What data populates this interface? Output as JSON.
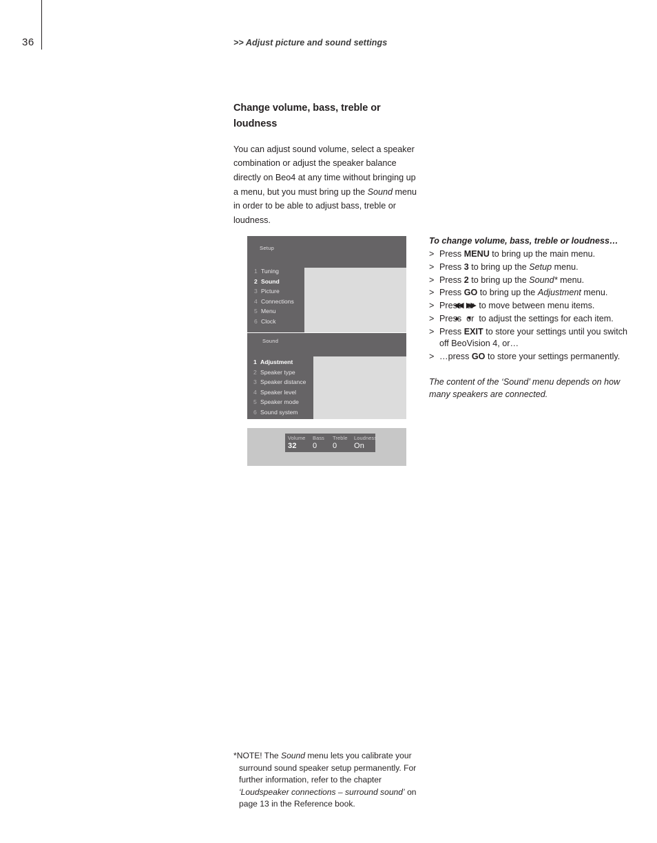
{
  "page": {
    "number": "36",
    "running_head": ">> Adjust picture and sound settings"
  },
  "left_column": {
    "heading": "Change volume, bass, treble or loudness",
    "intro_part1": "You can adjust sound volume, select a speaker combination or adjust the speaker balance directly on Beo4 at any time without bringing up a menu, but you must bring up the ",
    "intro_italic": "Sound",
    "intro_part2": " menu in order to be able to adjust bass, treble or loudness."
  },
  "tv_graphic": {
    "setup_menu": {
      "title": "Setup",
      "items": [
        {
          "num": "1",
          "label": "Tuning",
          "selected": false
        },
        {
          "num": "2",
          "label": "Sound",
          "selected": true
        },
        {
          "num": "3",
          "label": "Picture",
          "selected": false
        },
        {
          "num": "4",
          "label": "Connections",
          "selected": false
        },
        {
          "num": "5",
          "label": "Menu",
          "selected": false
        },
        {
          "num": "6",
          "label": "Clock",
          "selected": false
        }
      ]
    },
    "sound_menu": {
      "title": "Sound",
      "items": [
        {
          "num": "1",
          "label": "Adjustment",
          "selected": true
        },
        {
          "num": "2",
          "label": "Speaker type",
          "selected": false
        },
        {
          "num": "3",
          "label": "Speaker distance",
          "selected": false
        },
        {
          "num": "4",
          "label": "Speaker level",
          "selected": false
        },
        {
          "num": "5",
          "label": "Speaker mode",
          "selected": false
        },
        {
          "num": "6",
          "label": "Sound system",
          "selected": false
        }
      ]
    },
    "status_bar": [
      {
        "caption": "Volume",
        "value": "32"
      },
      {
        "caption": "Bass",
        "value": "0"
      },
      {
        "caption": "Treble",
        "value": "0"
      },
      {
        "caption": "Loudness",
        "value": "On"
      }
    ]
  },
  "right_column": {
    "title": "To change volume, bass, treble or loudness…",
    "steps": [
      {
        "marker": ">",
        "pre": "Press ",
        "key": "MENU",
        "mid": " to bring up the main menu.",
        "italic": "",
        "post": ""
      },
      {
        "marker": ">",
        "pre": "Press ",
        "key": "3",
        "mid": " to bring up the ",
        "italic": "Setup",
        "post": " menu."
      },
      {
        "marker": ">",
        "pre": "Press ",
        "key": "2",
        "mid": " to bring up the ",
        "italic": "Sound*",
        "post": " menu."
      },
      {
        "marker": ">",
        "pre": "Press ",
        "key": "GO",
        "mid": " to bring up the ",
        "italic": "Adjustment",
        "post": " menu."
      }
    ],
    "step_arrows_lr": {
      "marker": ">",
      "pre": "Press ",
      "rewind_glyph": "◀◀",
      "between": " or ",
      "forward_glyph": "▶▶",
      "post": " to move between menu items."
    },
    "step_arrows_ud": {
      "marker": ">",
      "pre": "Press ",
      "up_glyph": "▲",
      "between": " or ",
      "down_glyph": "▼",
      "post": " to adjust the settings for each item."
    },
    "step_exit": {
      "marker": ">",
      "pre": "Press ",
      "key": "EXIT",
      "post": " to store your settings until you switch off BeoVision 4, or…"
    },
    "step_go": {
      "marker": ">",
      "pre": "…press ",
      "key": "GO",
      "post": " to store your settings permanently."
    },
    "note": "The content of the ‘Sound’ menu depends on how many speakers are connected."
  },
  "footnote": {
    "part1": "*NOTE! The ",
    "italic1": "Sound",
    "part2": " menu lets you calibrate your surround sound speaker setup permanently. For further information, refer to the chapter ",
    "italic2": "‘Loudspeaker connections – surround sound’",
    "part3": " on page 13 in the Reference book."
  },
  "colors": {
    "menu_dark": "#666466",
    "menu_light": "#dcdcdc",
    "status_outer": "#c7c7c7",
    "text": "#231f20"
  }
}
